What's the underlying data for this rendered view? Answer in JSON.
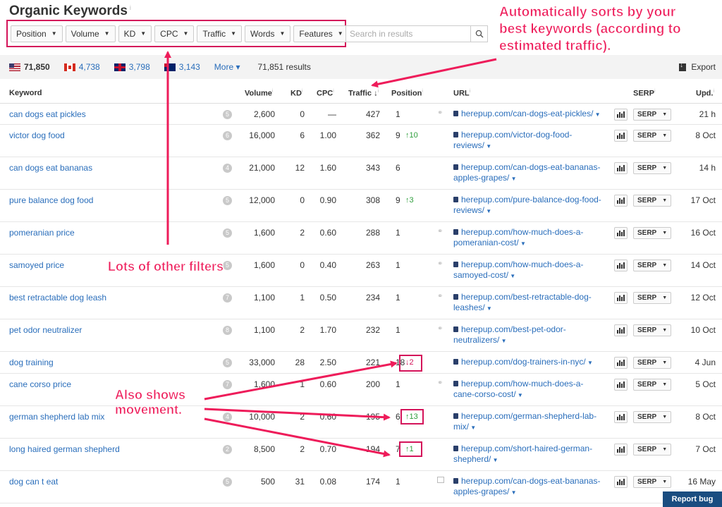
{
  "title": "Organic Keywords",
  "title_info": "i",
  "filters": [
    "Position",
    "Volume",
    "KD",
    "CPC",
    "Traffic",
    "Words",
    "Features"
  ],
  "search": {
    "placeholder": "Search in results"
  },
  "countries": [
    {
      "flag": "us-flag-icon",
      "value": "71,850",
      "active": true
    },
    {
      "flag": "ca-flag-icon",
      "value": "4,738",
      "active": false
    },
    {
      "flag": "gb-flag-icon",
      "value": "3,798",
      "active": false
    },
    {
      "flag": "au-flag-icon",
      "value": "3,143",
      "active": false
    }
  ],
  "more_label": "More ▾",
  "results_text": "71,851 results",
  "export_label": "Export",
  "columns": {
    "keyword": "Keyword",
    "volume": "Volume",
    "kd": "KD",
    "cpc": "CPC",
    "traffic": "Traffic ↓",
    "position": "Position",
    "url": "URL",
    "serp": "SERP",
    "upd": "Upd."
  },
  "rows": [
    {
      "keyword": "can dogs eat pickles",
      "badge": "5",
      "volume": "2,600",
      "kd": "0",
      "cpc": "—",
      "traffic": "427",
      "position": "1",
      "movement": "",
      "dir": "",
      "feature": "link",
      "url": "herepup.com/can-dogs-eat-pickles/",
      "serp": "SERP",
      "upd": "21 h"
    },
    {
      "keyword": "victor dog food",
      "badge": "6",
      "volume": "16,000",
      "kd": "6",
      "cpc": "1.00",
      "traffic": "362",
      "position": "9",
      "movement": "↑10",
      "dir": "up",
      "feature": "",
      "url": "herepup.com/victor-dog-food-reviews/",
      "serp": "SERP",
      "upd": "8 Oct"
    },
    {
      "keyword": "can dogs eat bananas",
      "badge": "4",
      "volume": "21,000",
      "kd": "12",
      "cpc": "1.60",
      "traffic": "343",
      "position": "6",
      "movement": "",
      "dir": "",
      "feature": "",
      "url": "herepup.com/can-dogs-eat-bananas-apples-grapes/",
      "serp": "SERP",
      "upd": "14 h"
    },
    {
      "keyword": "pure balance dog food",
      "badge": "5",
      "volume": "12,000",
      "kd": "0",
      "cpc": "0.90",
      "traffic": "308",
      "position": "9",
      "movement": "↑3",
      "dir": "up",
      "feature": "",
      "url": "herepup.com/pure-balance-dog-food-reviews/",
      "serp": "SERP",
      "upd": "17 Oct"
    },
    {
      "keyword": "pomeranian price",
      "badge": "5",
      "volume": "1,600",
      "kd": "2",
      "cpc": "0.60",
      "traffic": "288",
      "position": "1",
      "movement": "",
      "dir": "",
      "feature": "link",
      "url": "herepup.com/how-much-does-a-pomeranian-cost/",
      "serp": "SERP",
      "upd": "16 Oct"
    },
    {
      "keyword": "samoyed price",
      "badge": "5",
      "volume": "1,600",
      "kd": "0",
      "cpc": "0.40",
      "traffic": "263",
      "position": "1",
      "movement": "",
      "dir": "",
      "feature": "link",
      "url": "herepup.com/how-much-does-a-samoyed-cost/",
      "serp": "SERP",
      "upd": "14 Oct"
    },
    {
      "keyword": "best retractable dog leash",
      "badge": "7",
      "volume": "1,100",
      "kd": "1",
      "cpc": "0.50",
      "traffic": "234",
      "position": "1",
      "movement": "",
      "dir": "",
      "feature": "link",
      "url": "herepup.com/best-retractable-dog-leashes/",
      "serp": "SERP",
      "upd": "12 Oct"
    },
    {
      "keyword": "pet odor neutralizer",
      "badge": "8",
      "volume": "1,100",
      "kd": "2",
      "cpc": "1.70",
      "traffic": "232",
      "position": "1",
      "movement": "",
      "dir": "",
      "feature": "link",
      "url": "herepup.com/best-pet-odor-neutralizers/",
      "serp": "SERP",
      "upd": "10 Oct"
    },
    {
      "keyword": "dog training",
      "badge": "5",
      "volume": "33,000",
      "kd": "28",
      "cpc": "2.50",
      "traffic": "221",
      "position": "18",
      "movement": "↓2",
      "dir": "down",
      "feature": "",
      "url": "herepup.com/dog-trainers-in-nyc/",
      "serp": "SERP",
      "upd": "4 Jun"
    },
    {
      "keyword": "cane corso price",
      "badge": "7",
      "volume": "1,600",
      "kd": "1",
      "cpc": "0.60",
      "traffic": "200",
      "position": "1",
      "movement": "",
      "dir": "",
      "feature": "link",
      "url": "herepup.com/how-much-does-a-cane-corso-cost/",
      "serp": "SERP",
      "upd": "5 Oct"
    },
    {
      "keyword": "german shepherd lab mix",
      "badge": "4",
      "volume": "10,000",
      "kd": "2",
      "cpc": "0.60",
      "traffic": "195",
      "position": "6",
      "movement": "↑13",
      "dir": "up",
      "feature": "",
      "url": "herepup.com/german-shepherd-lab-mix/",
      "serp": "SERP",
      "upd": "8 Oct"
    },
    {
      "keyword": "long haired german shepherd",
      "badge": "2",
      "volume": "8,500",
      "kd": "2",
      "cpc": "0.70",
      "traffic": "194",
      "position": "7",
      "movement": "↑1",
      "dir": "up",
      "feature": "",
      "url": "herepup.com/short-haired-german-shepherd/",
      "serp": "SERP",
      "upd": "7 Oct"
    },
    {
      "keyword": "dog can t eat",
      "badge": "5",
      "volume": "500",
      "kd": "31",
      "cpc": "0.08",
      "traffic": "174",
      "position": "1",
      "movement": "",
      "dir": "",
      "feature": "image",
      "url": "herepup.com/can-dogs-eat-bananas-apples-grapes/",
      "serp": "SERP",
      "upd": "16 May"
    }
  ],
  "annotations": {
    "sort": "Automatically sorts by your best keywords (according to estimated traffic).",
    "filters": "Lots of other filters",
    "movement": "Also shows movement."
  },
  "report_bug": "Report bug",
  "accent_color": "#ee1c5a",
  "link_color": "#2a6ebb"
}
